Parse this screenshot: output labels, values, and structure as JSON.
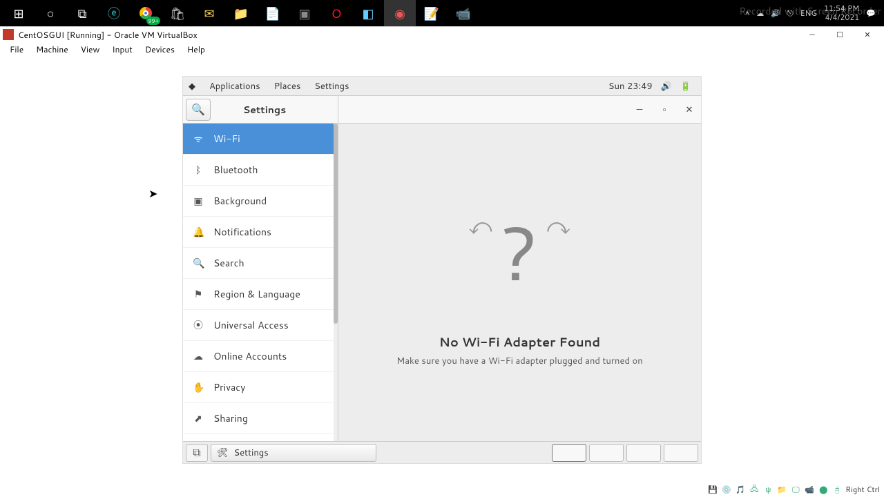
{
  "win_taskbar": {
    "items": [
      "start",
      "search",
      "taskview",
      "edge",
      "chrome",
      "store",
      "mail",
      "explorer",
      "word",
      "terminal",
      "opera",
      "virtualbox",
      "app1",
      "notepad",
      "snip"
    ],
    "clock_time": "11:54 PM",
    "clock_date": "4/4/2021",
    "lang": "ENG"
  },
  "watermark": "Recorded with Screen Recorder",
  "vbx": {
    "title": "CentOSGUI [Running] - Oracle VM VirtualBox",
    "menu": [
      "File",
      "Machine",
      "View",
      "Input",
      "Devices",
      "Help"
    ],
    "status_hint": "Right Ctrl"
  },
  "gnome_panel": {
    "applications": "Applications",
    "places": "Places",
    "active_app": "Settings",
    "clock": "Sun 23:49"
  },
  "settings": {
    "title": "Settings",
    "sidebar": [
      {
        "icon": "wifi",
        "label": "Wi-Fi",
        "selected": true
      },
      {
        "icon": "bluetooth",
        "label": "Bluetooth"
      },
      {
        "icon": "background",
        "label": "Background"
      },
      {
        "icon": "bell",
        "label": "Notifications"
      },
      {
        "icon": "search",
        "label": "Search"
      },
      {
        "icon": "globe",
        "label": "Region & Language"
      },
      {
        "icon": "person",
        "label": "Universal Access"
      },
      {
        "icon": "cloud",
        "label": "Online Accounts"
      },
      {
        "icon": "hand",
        "label": "Privacy"
      },
      {
        "icon": "share",
        "label": "Sharing"
      }
    ],
    "content": {
      "title": "No Wi-Fi Adapter Found",
      "subtitle": "Make sure you have a Wi-Fi adapter plugged and turned on"
    }
  },
  "gnome_bottom": {
    "task_label": "Settings"
  }
}
